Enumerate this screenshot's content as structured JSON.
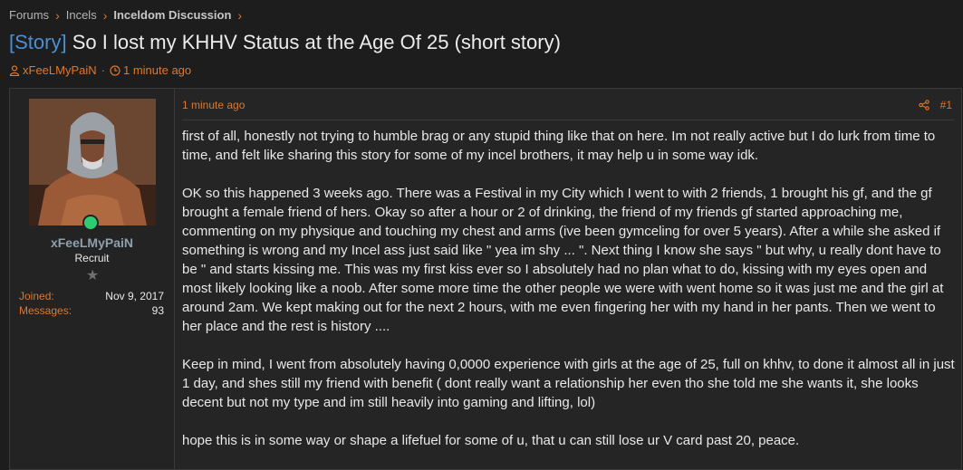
{
  "breadcrumb": [
    "Forums",
    "Incels",
    "Inceldom Discussion"
  ],
  "thread": {
    "prefix": "[Story]",
    "title": "So I lost my KHHV Status at the Age Of 25 (short story)",
    "author": "xFeeLMyPaiN",
    "time": "1 minute ago"
  },
  "user": {
    "name": "xFeeLMyPaiN",
    "role": "Recruit",
    "joined_label": "Joined:",
    "joined": "Nov 9, 2017",
    "messages_label": "Messages:",
    "messages": "93",
    "online": true
  },
  "post": {
    "time": "1 minute ago",
    "number": "#1",
    "paragraphs": [
      "first of all, honestly not trying to humble brag or any stupid thing like that on here. Im not really active but I do lurk from time to time, and felt like sharing this story for some of my incel brothers, it may help u in some way idk.",
      "OK so this happened 3 weeks ago. There was a Festival in my City which I went to with 2 friends, 1 brought his gf, and the gf brought a female friend of hers. Okay so after a hour or 2 of drinking, the friend of my friends gf started approaching me, commenting on my physique and touching my chest and arms (ive been gymceling for over 5 years). After a while she asked if something is wrong and my Incel ass just said like \" yea im shy ... \". Next thing I know she says \" but why, u really dont have to be \" and starts kissing me. This was my first kiss ever so I absolutely had no plan what to do, kissing with my eyes open and most likely looking like a noob. After some more time the other people we were with went home so it was just me and the girl at around 2am. We kept making out for the next 2 hours, with me even fingering her with my hand in her pants. Then we went to her place and the rest is history ....",
      "Keep in mind, I went from absolutely having 0,0000 experience with girls at the age of 25, full on khhv, to done it almost all in just 1 day, and shes still my friend with benefit ( dont really want a relationship her even tho she told me she wants it, she looks decent but not my type and im still heavily into gaming and lifting, lol)",
      "hope this is in some way or shape a lifefuel for some of u, that u can still lose ur V card past 20, peace."
    ]
  },
  "colors": {
    "accent": "#e0772c",
    "link": "#4b8fd6",
    "online": "#2ecc71"
  },
  "icons": [
    "user-icon",
    "clock-icon",
    "share-icon",
    "star-icon",
    "chevron-right-icon"
  ]
}
